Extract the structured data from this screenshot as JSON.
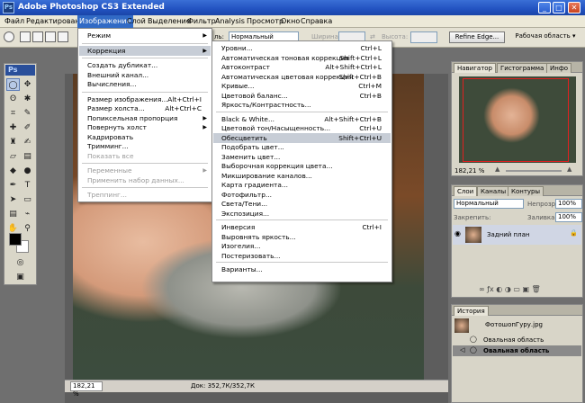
{
  "app": {
    "title": "Adobe Photoshop CS3 Extended",
    "logo": "Ps",
    "icon_text": "Ps"
  },
  "window_buttons": [
    {
      "name": "minimize-icon",
      "glyph": "_"
    },
    {
      "name": "restore-icon",
      "glyph": "□"
    },
    {
      "name": "close-icon",
      "glyph": "✕"
    }
  ],
  "menubar": [
    "Файл",
    "Редактирование",
    "Изображение",
    "Слой",
    "Выделение",
    "Фильтр",
    "Analysis",
    "Просмотр",
    "Окно",
    "Справка"
  ],
  "options_bar": {
    "feather_label": "ль:",
    "style_value": "Нормальный",
    "width_label": "Ширина:",
    "height_label": "Высота:",
    "refine_button": "Refine Edge...",
    "workspace_button": "Рабочая область ▾"
  },
  "image_menu": [
    {
      "label": "Режим",
      "arrow": "▶"
    },
    {
      "sep": true
    },
    {
      "label": "Коррекция",
      "arrow": "▶",
      "highlighted": true
    },
    {
      "sep": true
    },
    {
      "label": "Создать дубликат..."
    },
    {
      "label": "Внешний канал..."
    },
    {
      "label": "Вычисления..."
    },
    {
      "sep": true
    },
    {
      "label": "Размер изображения...",
      "shortcut": "Alt+Ctrl+I"
    },
    {
      "label": "Размер холста...",
      "shortcut": "Alt+Ctrl+C"
    },
    {
      "label": "Попиксельная пропорция",
      "arrow": "▶"
    },
    {
      "label": "Повернуть холст",
      "arrow": "▶"
    },
    {
      "label": "Кадрировать"
    },
    {
      "label": "Тримминг..."
    },
    {
      "label": "Показать все",
      "disabled": true
    },
    {
      "sep": true
    },
    {
      "label": "Переменные",
      "arrow": "▶",
      "disabled": true
    },
    {
      "label": "Применить набор данных...",
      "disabled": true
    },
    {
      "sep": true
    },
    {
      "label": "Треппинг...",
      "disabled": true
    }
  ],
  "correction_menu": [
    {
      "label": "Уровни...",
      "shortcut": "Ctrl+L"
    },
    {
      "label": "Автоматическая тоновая коррекция",
      "shortcut": "Shift+Ctrl+L"
    },
    {
      "label": "Автоконтраст",
      "shortcut": "Alt+Shift+Ctrl+L"
    },
    {
      "label": "Автоматическая цветовая коррекция",
      "shortcut": "Shift+Ctrl+B"
    },
    {
      "label": "Кривые...",
      "shortcut": "Ctrl+M"
    },
    {
      "label": "Цветовой баланс...",
      "shortcut": "Ctrl+B"
    },
    {
      "label": "Яркость/Контрастность..."
    },
    {
      "sep": true
    },
    {
      "label": "Black & White...",
      "shortcut": "Alt+Shift+Ctrl+B"
    },
    {
      "label": "Цветовой тон/Насыщенность...",
      "shortcut": "Ctrl+U"
    },
    {
      "label": "Обесцветить",
      "shortcut": "Shift+Ctrl+U",
      "highlighted": true
    },
    {
      "label": "Подобрать цвет..."
    },
    {
      "label": "Заменить цвет..."
    },
    {
      "label": "Выборочная коррекция цвета..."
    },
    {
      "label": "Микширование каналов..."
    },
    {
      "label": "Карта градиента..."
    },
    {
      "label": "Фотофильтр..."
    },
    {
      "label": "Света/Тени..."
    },
    {
      "label": "Экспозиция..."
    },
    {
      "sep": true
    },
    {
      "label": "Инверсия",
      "shortcut": "Ctrl+I"
    },
    {
      "label": "Выровнять яркость..."
    },
    {
      "label": "Изогелия..."
    },
    {
      "label": "Постеризовать..."
    },
    {
      "sep": true
    },
    {
      "label": "Варианты..."
    }
  ],
  "document": {
    "zoom": "182,21 %",
    "doc_info": "Док: 352,7К/352,7К"
  },
  "navigator": {
    "tabs": [
      "Навигатор",
      "Гистограмма",
      "Инфо"
    ],
    "zoom": "182,21 %"
  },
  "layers": {
    "tabs": [
      "Слои",
      "Каналы",
      "Контуры"
    ],
    "blend_mode": "Нормальный",
    "opacity_label": "Непрозр.:",
    "opacity_value": "100%",
    "lock_label": "Закрепить:",
    "fill_label": "Заливка:",
    "fill_value": "100%",
    "layer_name": "Задний план"
  },
  "history": {
    "tabs": [
      "История"
    ],
    "snapshot": "ФотошопГуру.jpg",
    "states": [
      "Овальная область",
      "Овальная область"
    ]
  },
  "colors": {
    "menu_highlight": "#c7cdd6",
    "menubar_active": "#316ac5",
    "title_blue": "#2252c0",
    "nav_box": "#e02020"
  }
}
